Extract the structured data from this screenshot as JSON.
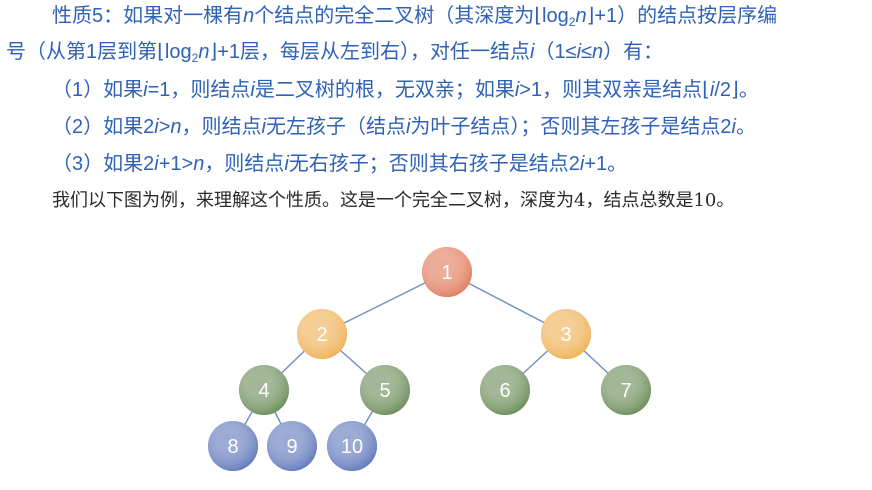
{
  "property": {
    "line1": {
      "a": "性质5：如果对一棵有",
      "b": "n",
      "c": "个结点的完全二叉树（其深度为⌊log",
      "d": "2",
      "e": "n",
      "f": "⌋+1）的结点按层序编"
    },
    "line2": {
      "a": "号（从第1层到第⌊log",
      "b": "2",
      "c": "n",
      "d": "⌋+1层，每层从左到右），对任一结点",
      "e": "i",
      "f": "（1≤",
      "g": "i",
      "h": "≤",
      "i": "n",
      "j": "）有："
    },
    "item1": {
      "a": "（1）如果",
      "b": "i",
      "c": "=1，则结点",
      "d": "i",
      "e": "是二叉树的根，无双亲；如果",
      "f": "i",
      "g": ">1，则其双亲是结点⌊",
      "h": "i",
      "i": "/2⌋。"
    },
    "item2": {
      "a": "（2）如果2",
      "b": "i",
      "c": ">",
      "d": "n",
      "e": "，则结点",
      "f": "i",
      "g": "无左孩子（结点",
      "h": "i",
      "i": "为叶子结点）；否则其左孩子是结点2",
      "j": "i",
      "k": "。"
    },
    "item3": {
      "a": "（3）如果2",
      "b": "i",
      "c": "+1>",
      "d": "n",
      "e": "，则结点",
      "f": "i",
      "g": "无右孩子；否则其右孩子是结点2",
      "h": "i",
      "i": "+1。"
    }
  },
  "example_text": "我们以下图为例，来理解这个性质。这是一个完全二叉树，深度为4，结点总数是10。",
  "tree": {
    "level_colors": [
      "#e07a5c",
      "#efb054",
      "#6a8c58",
      "#5f78bb"
    ],
    "nodes": [
      {
        "label": "1",
        "level": 0
      },
      {
        "label": "2",
        "level": 1
      },
      {
        "label": "3",
        "level": 1
      },
      {
        "label": "4",
        "level": 2
      },
      {
        "label": "5",
        "level": 2
      },
      {
        "label": "6",
        "level": 2
      },
      {
        "label": "7",
        "level": 2
      },
      {
        "label": "8",
        "level": 3
      },
      {
        "label": "9",
        "level": 3
      },
      {
        "label": "10",
        "level": 3
      }
    ],
    "edges": [
      [
        "1",
        "2"
      ],
      [
        "1",
        "3"
      ],
      [
        "2",
        "4"
      ],
      [
        "2",
        "5"
      ],
      [
        "3",
        "6"
      ],
      [
        "3",
        "7"
      ],
      [
        "4",
        "8"
      ],
      [
        "4",
        "9"
      ],
      [
        "5",
        "10"
      ]
    ]
  }
}
